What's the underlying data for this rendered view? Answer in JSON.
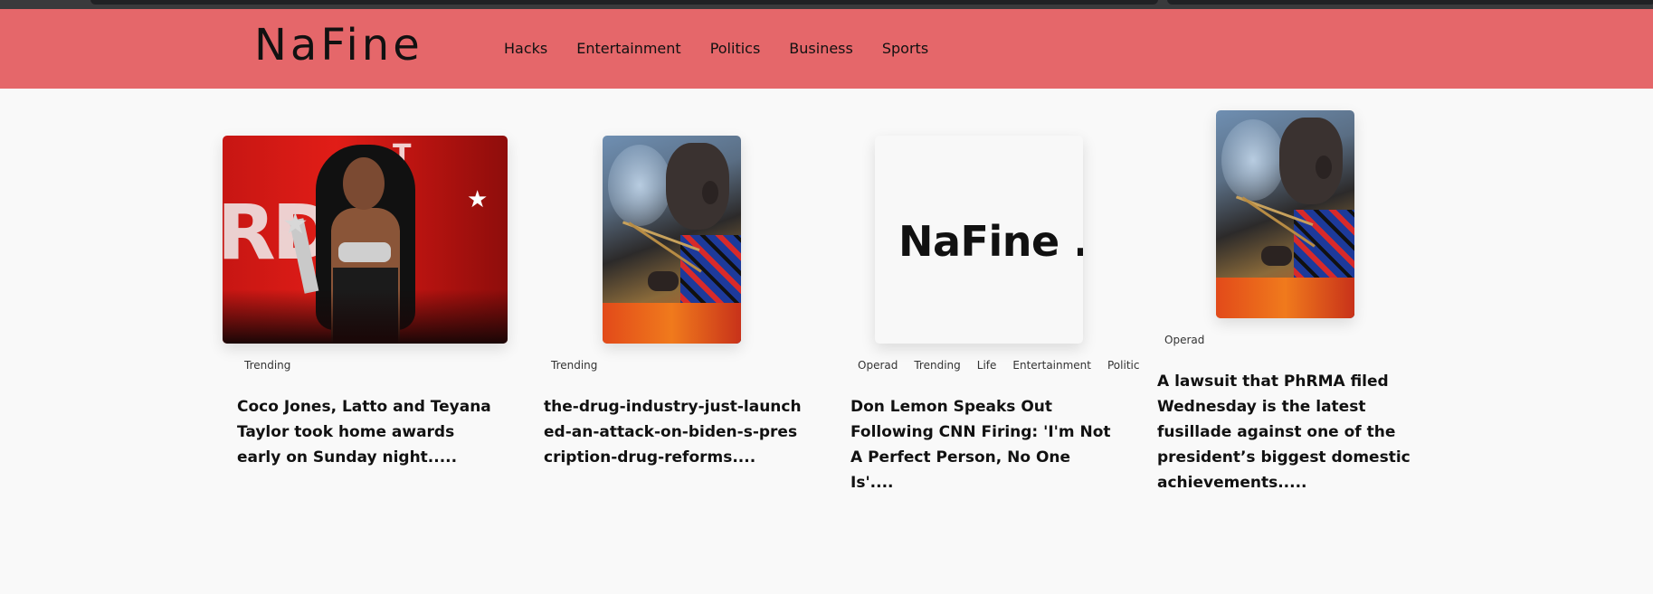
{
  "site": {
    "logo": "NaFine",
    "nav": [
      "Hacks",
      "Entertainment",
      "Politics",
      "Business",
      "Sports"
    ]
  },
  "posts": [
    {
      "image": "awards-stage-photo",
      "tags": [
        "Trending"
      ],
      "title": "Coco Jones, Latto and Teyana Taylor took home awards early on Sunday night....."
    },
    {
      "image": "fire-making-photo",
      "tags": [
        "Trending"
      ],
      "title": "the-drug-industry-just-launched-an-attack-on-biden-s-prescription-drug-reforms...."
    },
    {
      "image": "nafine-logo-card",
      "image_text": "NaFine .",
      "tags": [
        "Operad",
        "Trending",
        "Life",
        "Entertainment",
        "Politic"
      ],
      "title": "Don Lemon Speaks Out Following CNN Firing: 'I'm Not A Perfect Person, No One Is'...."
    },
    {
      "image": "fire-making-photo",
      "tags": [
        "Operad"
      ],
      "title": "A lawsuit that PhRMA filed Wednesday is the latest fusillade against one of the president’s biggest domestic achievements....."
    }
  ],
  "colors": {
    "header_bg": "#e5676a",
    "page_bg": "#f9f9f9"
  }
}
